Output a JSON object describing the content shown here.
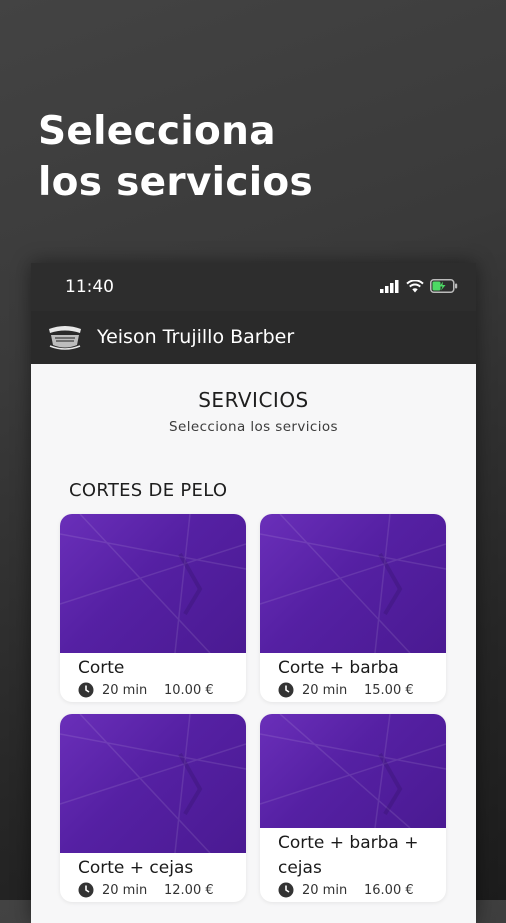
{
  "headline": {
    "line1": "Selecciona",
    "line2": "los servicios"
  },
  "status_bar": {
    "time": "11:40"
  },
  "app_bar": {
    "title": "Yeison Trujillo Barber"
  },
  "section": {
    "title": "SERVICIOS",
    "subtitle": "Selecciona los servicios"
  },
  "category": {
    "title": "CORTES DE PELO"
  },
  "services": [
    {
      "name": "Corte",
      "duration": "20 min",
      "price": "10.00 €"
    },
    {
      "name": "Corte + barba",
      "duration": "20 min",
      "price": "15.00 €"
    },
    {
      "name": "Corte + cejas",
      "duration": "20 min",
      "price": "12.00 €"
    },
    {
      "name": "Corte + barba + cejas",
      "duration": "20 min",
      "price": "16.00 €"
    }
  ],
  "colors": {
    "card_image": "#5a24a8",
    "app_bar": "#2a2a2a",
    "background": "#f7f7f8"
  },
  "icons": [
    "signal-icon",
    "wifi-icon",
    "battery-icon",
    "clock-icon",
    "barber-logo"
  ]
}
